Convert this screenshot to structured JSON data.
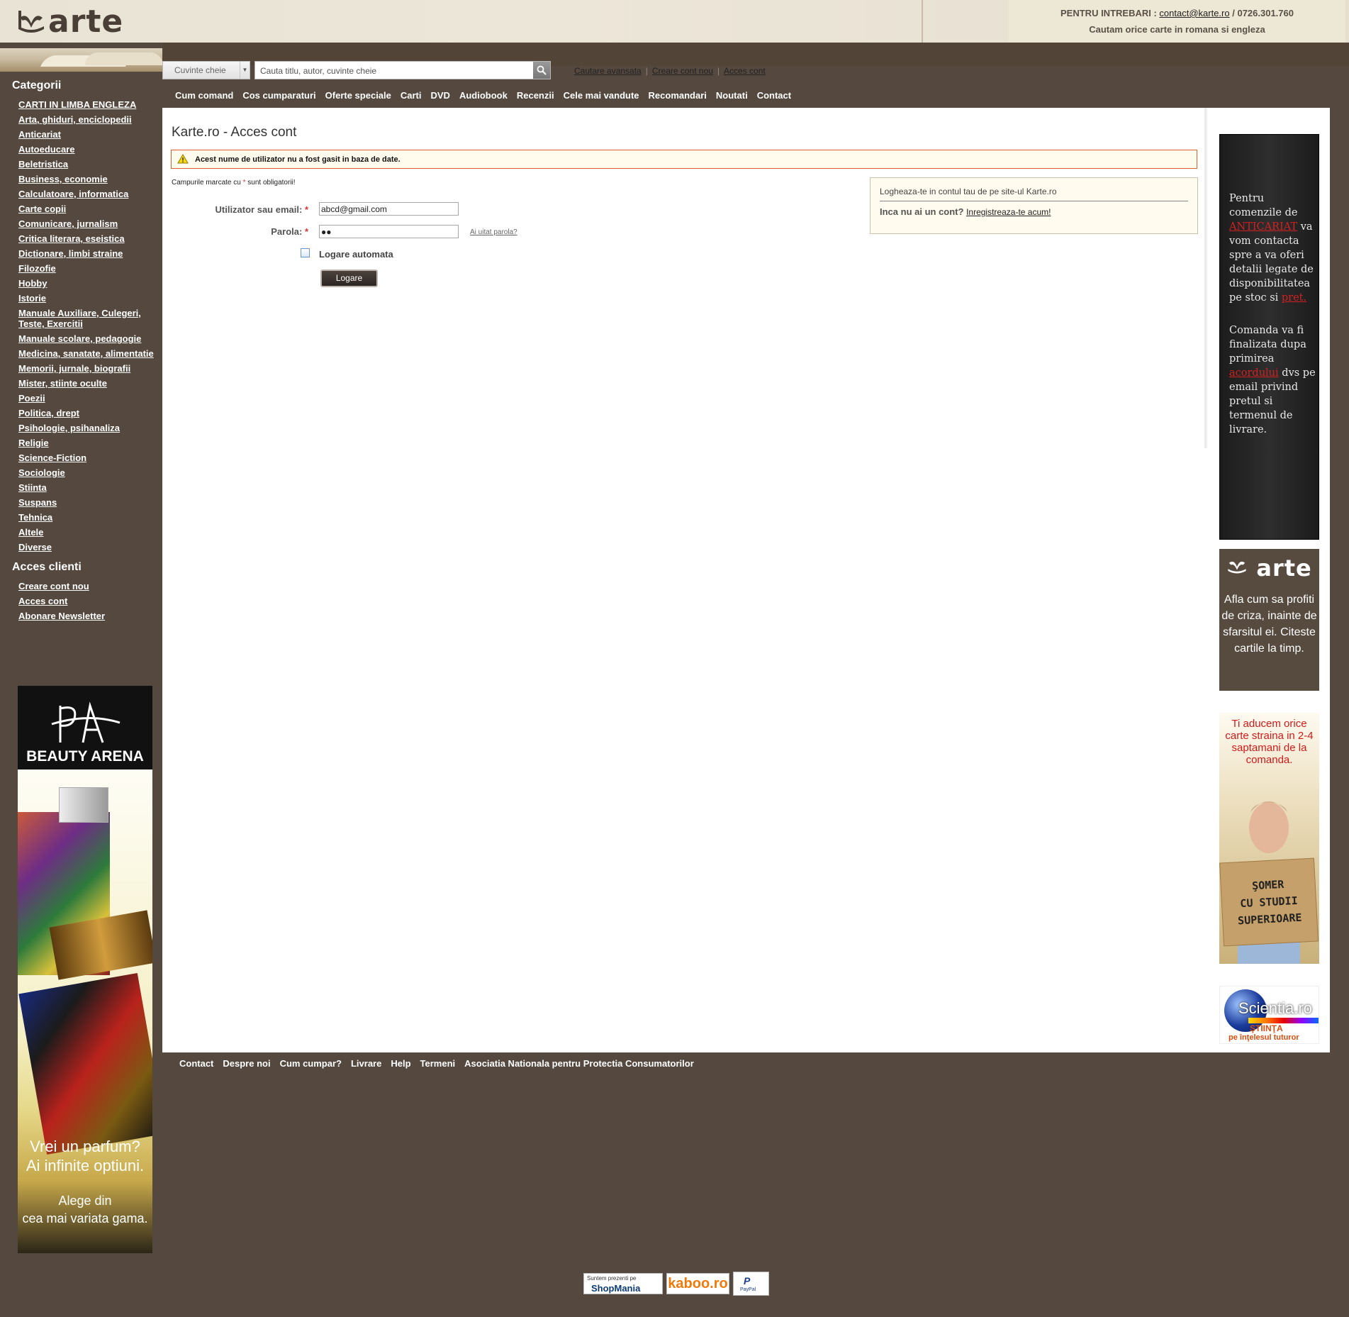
{
  "header": {
    "logo_text": "arte",
    "contact_label": "PENTRU INTREBARI :",
    "contact_email": "contact@karte.ro",
    "contact_phone": "/ 0726.301.760",
    "tagline": "Cautam orice carte in romana si engleza"
  },
  "search": {
    "select_value": "Cuvinte cheie",
    "placeholder": "Cauta titlu, autor, cuvinte cheie",
    "links": [
      "Cautare avansata",
      "Creare cont nou",
      "Acces cont"
    ]
  },
  "nav": [
    "Cum comand",
    "Cos cumparaturi",
    "Oferte speciale",
    "Carti",
    "DVD",
    "Audiobook",
    "Recenzii",
    "Cele mai vandute",
    "Recomandari",
    "Noutati",
    "Contact"
  ],
  "sidebar": {
    "categories_title": "Categorii",
    "categories": [
      "CARTI IN LIMBA ENGLEZA",
      "Arta, ghiduri, enciclopedii",
      "Anticariat",
      "Autoeducare",
      "Beletristica",
      "Business, economie",
      "Calculatoare, informatica",
      "Carte copii",
      "Comunicare, jurnalism",
      "Critica literara, eseistica",
      "Dictionare, limbi straine",
      "Filozofie",
      "Hobby",
      "Istorie",
      "Manuale Auxiliare, Culegeri, Teste, Exercitii",
      "Manuale scolare, pedagogie",
      "Medicina, sanatate, alimentatie",
      "Memorii, jurnale, biografii",
      "Mister, stiinte oculte",
      "Poezii",
      "Politica, drept",
      "Psihologie, psihanaliza",
      "Religie",
      "Science-Fiction",
      "Sociologie",
      "Stiinta",
      "Suspans",
      "Tehnica",
      "Altele",
      "Diverse"
    ],
    "clients_title": "Acces clienti",
    "clients": [
      "Creare cont nou",
      "Acces cont",
      "Abonare Newsletter"
    ]
  },
  "beauty_ad": {
    "brand": "BEAUTY ARENA",
    "line1": "Vrei un parfum?",
    "line2": "Ai infinite optiuni.",
    "line3": "Alege din",
    "line4": "cea mai variata gama."
  },
  "main": {
    "title": "Karte.ro - Acces cont",
    "error": "Acest nume de utilizator nu a fost gasit in baza de date.",
    "required_note_a": "Campurile marcate cu",
    "required_star": "*",
    "required_note_b": "sunt obligatorii!",
    "user_label": "Utilizator sau email:",
    "user_value": "abcd@gmail.com",
    "pass_label": "Parola:",
    "pass_value": "●●",
    "forgot": "Ai uitat parola?",
    "auto_login": "Logare automata",
    "login_button": "Logare",
    "box_title": "Logheaza-te in contul tau de pe site-ul Karte.ro",
    "box_question": "Inca nu ai un cont?",
    "box_link": "Inregistreaza-te acum!"
  },
  "right_ads": {
    "ad1": {
      "p1_a": "Pentru comenzile de",
      "p1_red": "ANTICARIAT",
      "p1_b": "va vom contacta spre a va oferi detalii legate de disponibilitatea pe stoc si",
      "p1_red2": "pret.",
      "p2_a": "Comanda va fi finalizata dupa primirea",
      "p2_red": "acordului",
      "p2_b": "dvs pe email privind pretul si termenul de livrare."
    },
    "ad2": {
      "logo": "arte",
      "text": "Afla cum sa profiti de criza, inainte de sfarsitul ei.",
      "bold": "Citeste cartile la timp."
    },
    "ad3": {
      "text": "Ti aducem orice carte straina in 2-4 saptamani de la comanda.",
      "sign1": "ŞOMER",
      "sign2": "CU STUDII",
      "sign3": "SUPERIOARE"
    },
    "ad4": {
      "name": "Scientia.ro",
      "tag1": "ŞTIINŢA",
      "tag2": "pe înţelesul tuturor"
    }
  },
  "footer": {
    "links": [
      "Contact",
      "Despre noi",
      "Cum cumpar?",
      "Livrare",
      "Help",
      "Termeni",
      "Asociatia Nationala pentru Protectia Consumatorilor"
    ],
    "shopmania_top": "Suntem prezenti pe",
    "shopmania": "ShopMania",
    "kaboo": "kaboo.ro",
    "paypal": "P",
    "paypal_name": "PayPal"
  },
  "colors": {
    "page_bg": "#54483f",
    "error_border": "#e0602c",
    "accent_red": "#d32020"
  }
}
